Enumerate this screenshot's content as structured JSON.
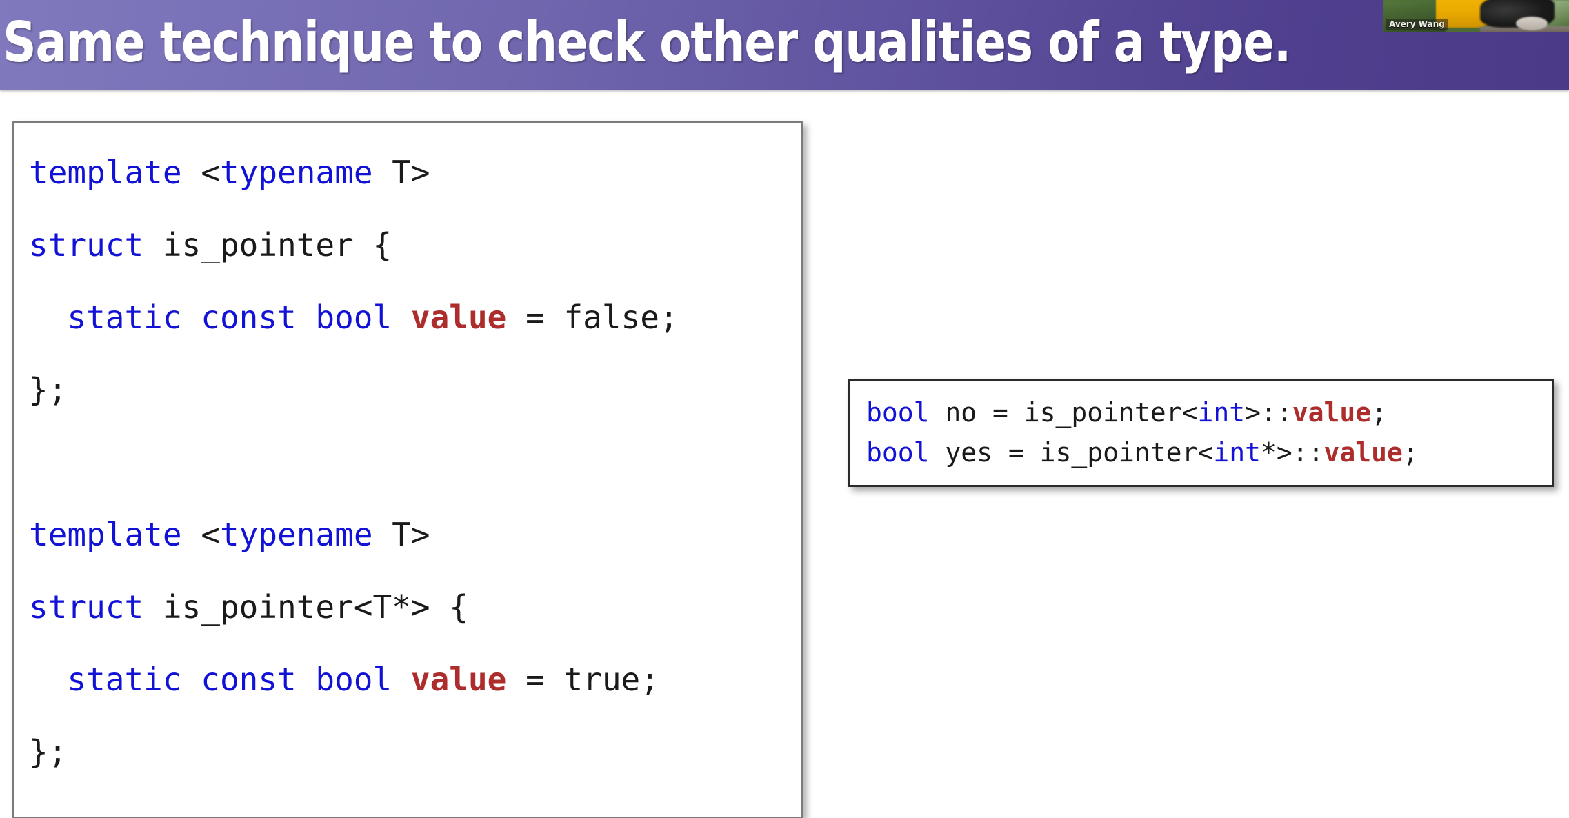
{
  "slide": {
    "title": "Same technique to check other qualities of a type.",
    "header_gradient_from": "#8079bd",
    "header_gradient_to": "#4a3a87",
    "title_color": "#ffffff",
    "background_color": "#ffffff"
  },
  "webcam": {
    "participant_name": "Avery Wang",
    "icon": "webcam-video-thumbnail"
  },
  "code_colors": {
    "keyword": "#1212d6",
    "identifier": "#1a1a1a",
    "member_value": "#ad2d2d",
    "box_border_main": "#7b7b7b",
    "box_border_usage": "#2b2b2b"
  },
  "main_code": {
    "language": "cpp",
    "full_text": "template <typename T>\nstruct is_pointer {\n  static const bool value = false;\n};\n\ntemplate <typename T>\nstruct is_pointer<T*> {\n  static const bool value = true;\n};",
    "lines": [
      {
        "index": 0,
        "text": "template <typename T>",
        "tokens": [
          {
            "t": "template",
            "c": "kw"
          },
          {
            "t": " <",
            "c": "punc"
          },
          {
            "t": "typename",
            "c": "kw"
          },
          {
            "t": " T>",
            "c": "id"
          }
        ]
      },
      {
        "index": 1,
        "text": "struct is_pointer {",
        "tokens": [
          {
            "t": "struct",
            "c": "kw"
          },
          {
            "t": " is_pointer {",
            "c": "id"
          }
        ]
      },
      {
        "index": 2,
        "text": "  static const bool value = false;",
        "tokens": [
          {
            "t": "  ",
            "c": "punc"
          },
          {
            "t": "static const bool",
            "c": "kw"
          },
          {
            "t": " ",
            "c": "punc"
          },
          {
            "t": "value",
            "c": "val"
          },
          {
            "t": " = false;",
            "c": "id"
          }
        ]
      },
      {
        "index": 3,
        "text": "};",
        "tokens": [
          {
            "t": "};",
            "c": "id"
          }
        ]
      },
      {
        "index": 4,
        "text": "",
        "tokens": []
      },
      {
        "index": 5,
        "text": "template <typename T>",
        "tokens": [
          {
            "t": "template",
            "c": "kw"
          },
          {
            "t": " <",
            "c": "punc"
          },
          {
            "t": "typename",
            "c": "kw"
          },
          {
            "t": " T>",
            "c": "id"
          }
        ]
      },
      {
        "index": 6,
        "text": "struct is_pointer<T*> {",
        "tokens": [
          {
            "t": "struct",
            "c": "kw"
          },
          {
            "t": " is_pointer<T*> {",
            "c": "id"
          }
        ]
      },
      {
        "index": 7,
        "text": "  static const bool value = true;",
        "tokens": [
          {
            "t": "  ",
            "c": "punc"
          },
          {
            "t": "static const bool",
            "c": "kw"
          },
          {
            "t": " ",
            "c": "punc"
          },
          {
            "t": "value",
            "c": "val"
          },
          {
            "t": " = true;",
            "c": "id"
          }
        ]
      },
      {
        "index": 8,
        "text": "};",
        "tokens": [
          {
            "t": "};",
            "c": "id"
          }
        ]
      }
    ]
  },
  "usage_code": {
    "language": "cpp",
    "full_text": "bool no = is_pointer<int>::value;\nbool yes = is_pointer<int*>::value;",
    "lines": [
      {
        "index": 0,
        "text": "bool no = is_pointer<int>::value;",
        "tokens": [
          {
            "t": "bool",
            "c": "kw"
          },
          {
            "t": " no = is_pointer<",
            "c": "id"
          },
          {
            "t": "int",
            "c": "kw"
          },
          {
            "t": ">::",
            "c": "id"
          },
          {
            "t": "value",
            "c": "val"
          },
          {
            "t": ";",
            "c": "id"
          }
        ]
      },
      {
        "index": 1,
        "text": "bool yes = is_pointer<int*>::value;",
        "tokens": [
          {
            "t": "bool",
            "c": "kw"
          },
          {
            "t": " yes = is_pointer<",
            "c": "id"
          },
          {
            "t": "int",
            "c": "kw"
          },
          {
            "t": "*>::",
            "c": "id"
          },
          {
            "t": "value",
            "c": "val"
          },
          {
            "t": ";",
            "c": "id"
          }
        ]
      }
    ]
  }
}
